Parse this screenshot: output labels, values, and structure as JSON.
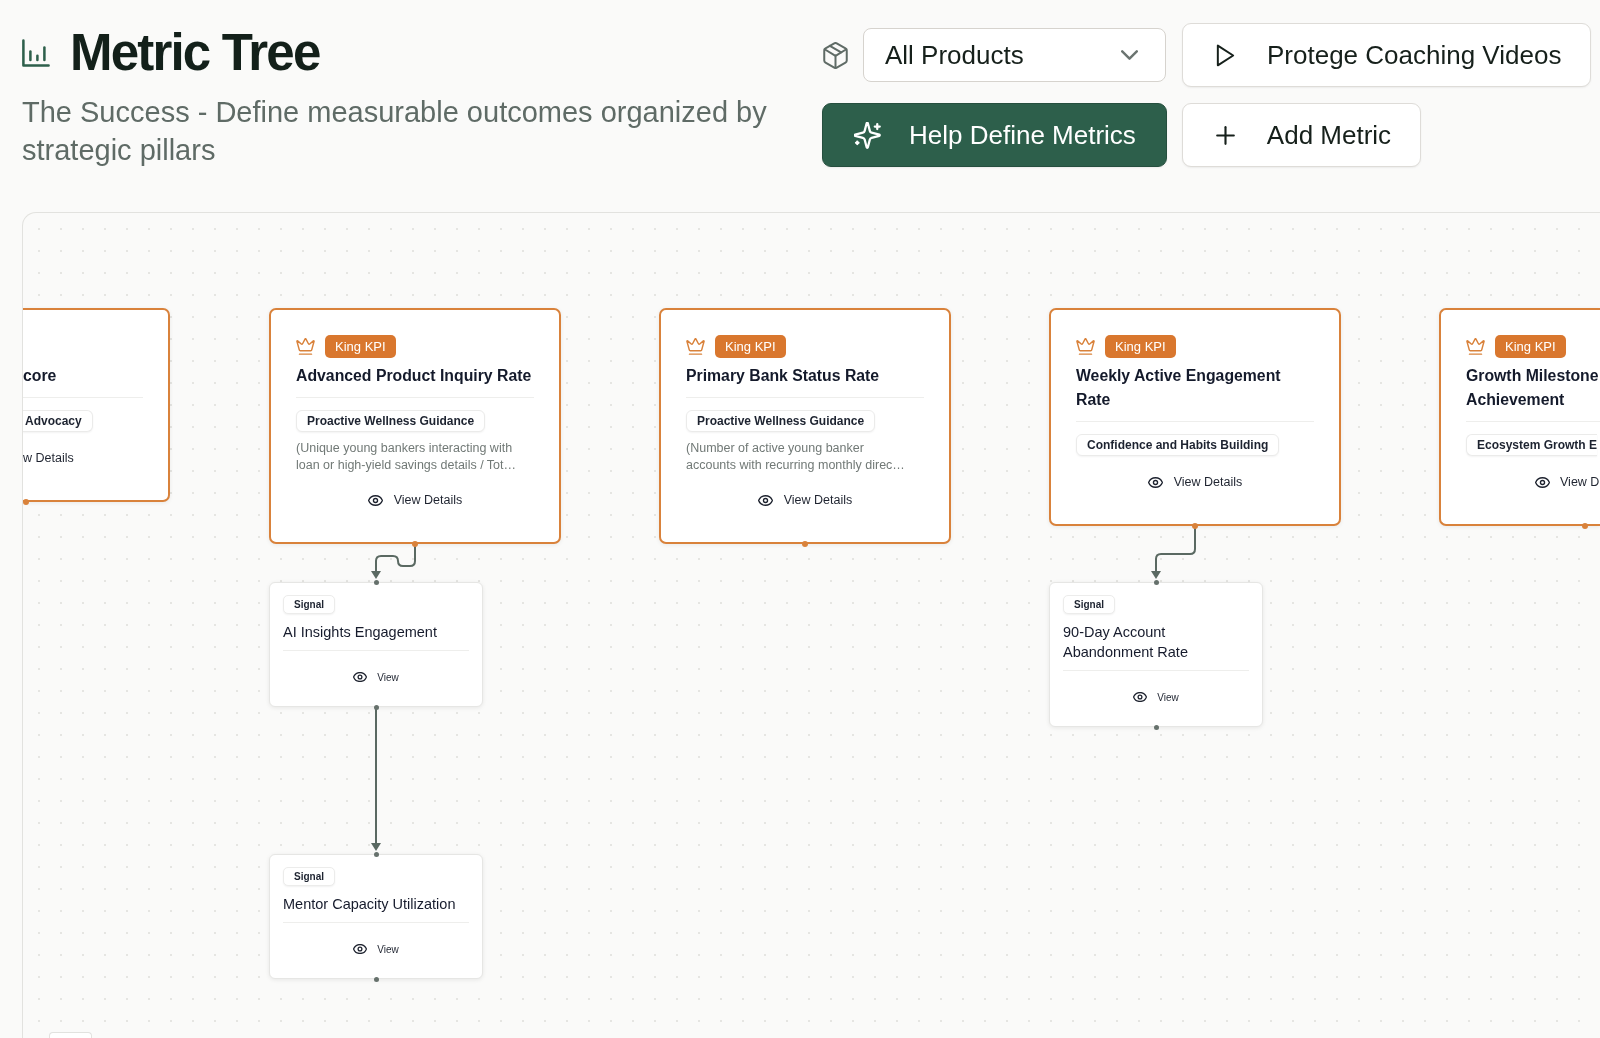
{
  "header": {
    "title": "Metric Tree",
    "subtitle": "The Success - Define measurable outcomes organized by strategic pillars"
  },
  "toolbar": {
    "product_filter": {
      "value": "All Products"
    },
    "buttons": [
      {
        "kind": "video",
        "label": "Protege Coaching Videos"
      },
      {
        "kind": "assist",
        "label": "Help Define Metrics"
      },
      {
        "kind": "add",
        "label": "Add Metric"
      }
    ]
  },
  "tree": {
    "nodes": [
      {
        "kind": "king_kpi",
        "title": "core",
        "pillar": "Advocacy",
        "action": "w Details"
      },
      {
        "kind": "king_kpi",
        "badge": "King KPI",
        "title": "Advanced Product Inquiry Rate",
        "pillar": "Proactive Wellness Guidance",
        "description": "(Unique young bankers interacting with loan or high-yield savings details / Tot…",
        "action": "View Details",
        "children": [
          {
            "kind": "signal",
            "badge": "Signal",
            "title": "AI Insights Engagement",
            "action": "View",
            "children": [
              {
                "kind": "signal",
                "badge": "Signal",
                "title": "Mentor Capacity Utilization",
                "action": "View"
              }
            ]
          }
        ]
      },
      {
        "kind": "king_kpi",
        "badge": "King KPI",
        "title": "Primary Bank Status Rate",
        "pillar": "Proactive Wellness Guidance",
        "description": "(Number of active young banker accounts with recurring monthly direc…",
        "action": "View Details"
      },
      {
        "kind": "king_kpi",
        "badge": "King KPI",
        "title": "Weekly Active Engagement Rate",
        "pillar": "Confidence and Habits Building",
        "action": "View Details",
        "children": [
          {
            "kind": "signal",
            "badge": "Signal",
            "title": "90-Day Account Abandonment Rate",
            "action": "View"
          }
        ]
      },
      {
        "kind": "king_kpi",
        "badge": "King KPI",
        "title": "Growth Milestone Achievement",
        "pillar": "Ecosystem Growth E",
        "action": "View D"
      }
    ]
  }
}
